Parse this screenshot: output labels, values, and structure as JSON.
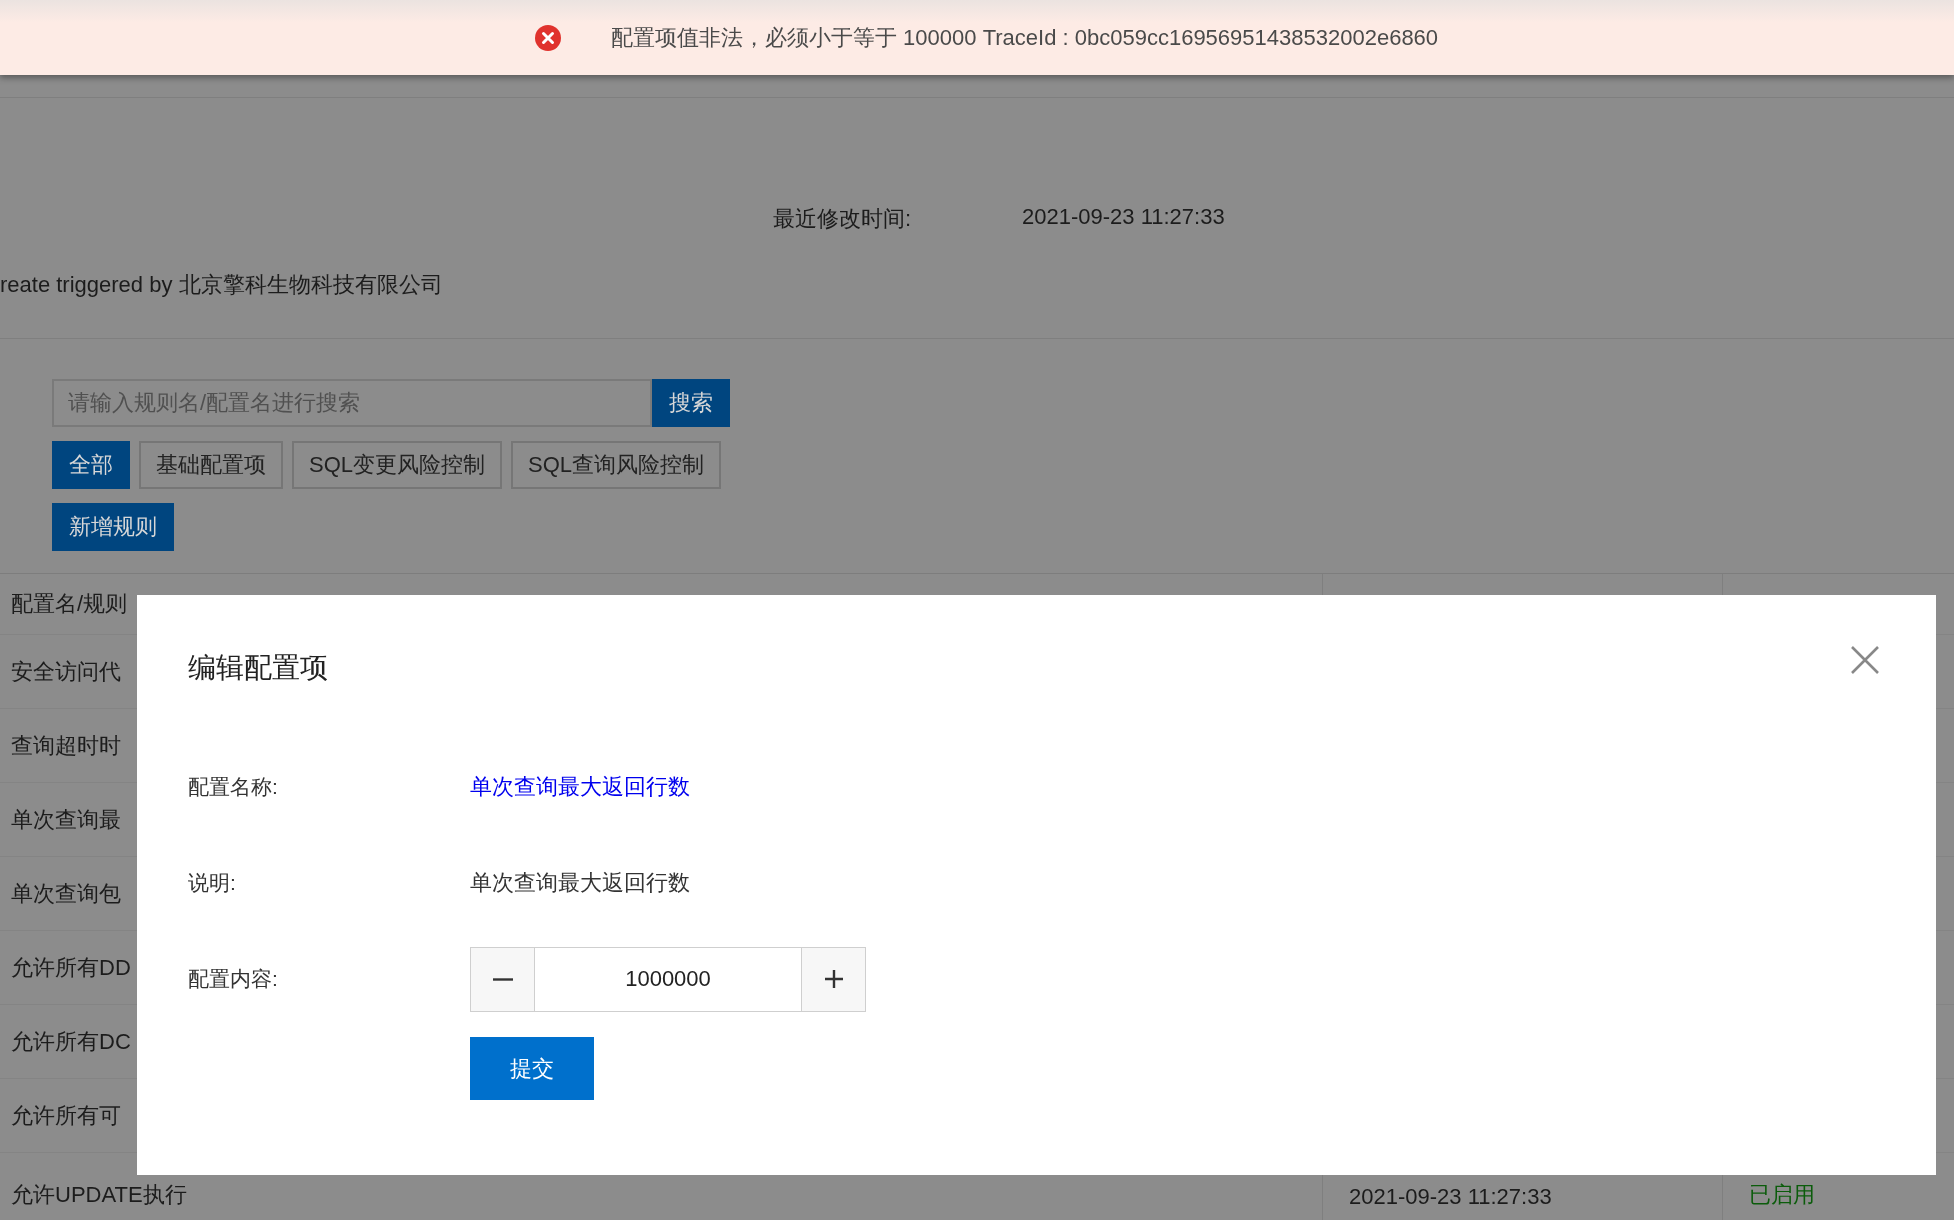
{
  "toast": {
    "kind": "error",
    "message": "配置项值非法，必须小于等于 100000 TraceId : 0bc059cc16956951438532002e6860"
  },
  "info": {
    "modified_label": "最近修改时间:",
    "modified_value": "2021-09-23 11:27:33",
    "description": "reate triggered by 北京擎科生物科技有限公司"
  },
  "search": {
    "placeholder": "请输入规则名/配置名进行搜索",
    "button": "搜索"
  },
  "filter_tabs": [
    {
      "label": "全部",
      "selected": true
    },
    {
      "label": "基础配置项",
      "selected": false
    },
    {
      "label": "SQL变更风险控制",
      "selected": false
    },
    {
      "label": "SQL查询风险控制",
      "selected": false
    }
  ],
  "add_button": "新增规则",
  "table": {
    "columns": [
      "配置名/规则"
    ],
    "rows": [
      {
        "column_1": "安全访问代"
      },
      {
        "column_1": "查询超时时"
      },
      {
        "column_1": "单次查询最"
      },
      {
        "column_1": "单次查询包"
      },
      {
        "column_1": "允许所有DD"
      },
      {
        "column_1": "允许所有DC"
      },
      {
        "column_1": "允许所有可"
      },
      {
        "column_1": "允许UPDATE执行",
        "column_2": "2021-09-23 11:27:33",
        "column_3": "已启用"
      }
    ]
  },
  "modal": {
    "title": "编辑配置项",
    "fields": [
      {
        "kind": "link",
        "label": "配置名称:",
        "value": "单次查询最大返回行数"
      },
      {
        "kind": "text",
        "label": "说明:",
        "value": "单次查询最大返回行数"
      },
      {
        "kind": "number",
        "label": "配置内容:",
        "value": "1000000"
      }
    ],
    "submit": "提交"
  }
}
